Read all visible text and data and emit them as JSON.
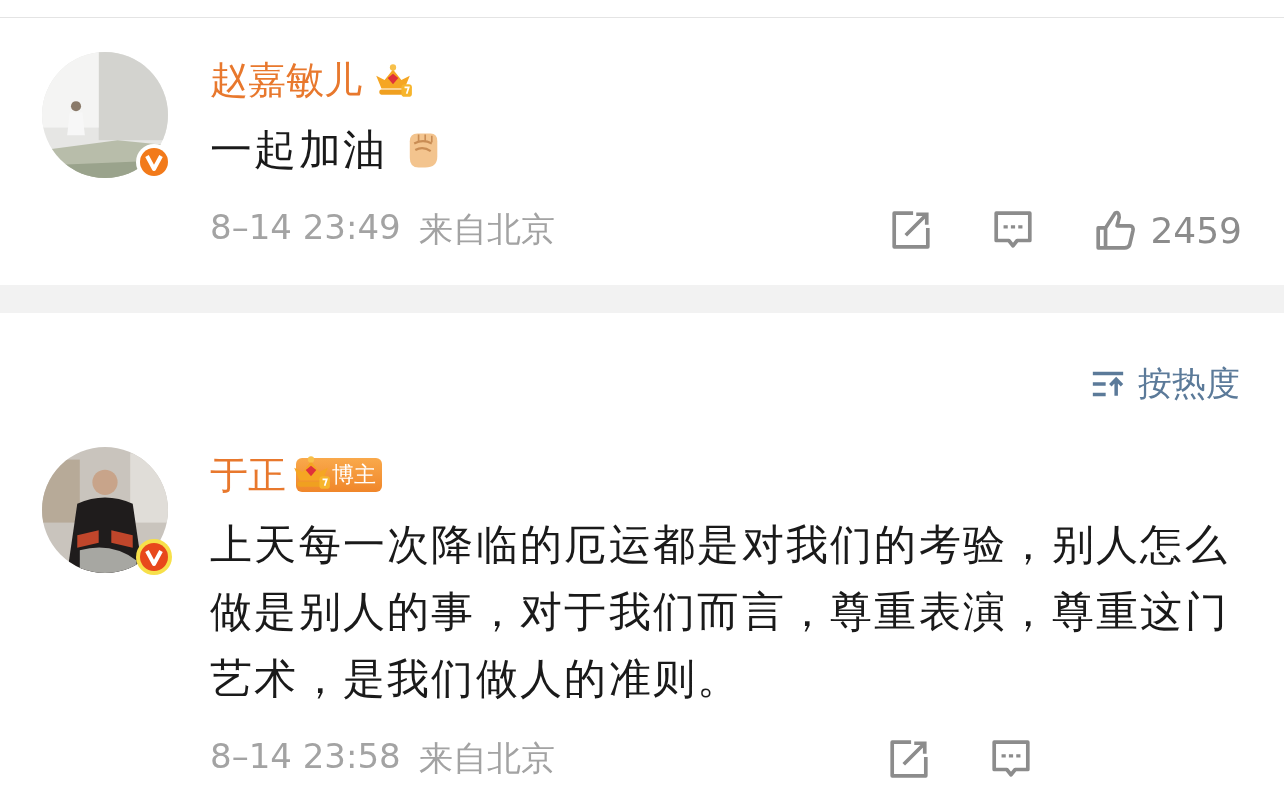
{
  "comments": [
    {
      "user": {
        "name": "赵嘉敏儿"
      },
      "text": "一起加油",
      "fist_emoji": true,
      "time": "8–14 23:49",
      "location": "来自北京",
      "likes": "2459"
    },
    {
      "user": {
        "name": "于正",
        "badge_label": "博主"
      },
      "text": "上天每一次降临的厄运都是对我们的考验，别人怎么做是别人的事，对于我们而言，尊重表演，尊重这门艺术，是我们做人的准则。",
      "fist_emoji": false,
      "time": "8–14 23:58",
      "location": "来自北京"
    }
  ],
  "sort": {
    "label": "按热度"
  }
}
